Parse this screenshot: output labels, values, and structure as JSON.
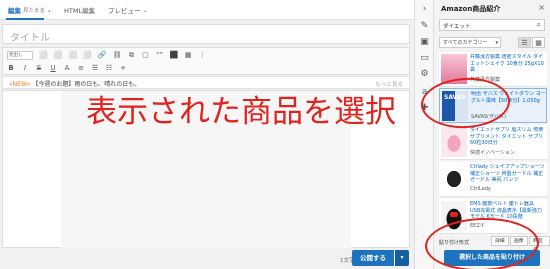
{
  "editor": {
    "tabs": [
      {
        "label": "編集",
        "sub": "見たまま"
      },
      {
        "label": "HTML編集"
      },
      {
        "label": "プレビュー"
      }
    ],
    "title_placeholder": "タイトル",
    "toolbar": {
      "select_label": "見出し",
      "row1": [
        "⬜",
        "⬜",
        "⬜",
        "⬜",
        "🔗",
        "⛓",
        "⧉",
        "▢",
        "“”",
        "⬛",
        "▦",
        "⋮"
      ],
      "row2": [
        "B",
        "I",
        "S",
        "U",
        "A",
        "≡",
        "☰",
        "☷",
        "+"
      ]
    },
    "snippet": {
      "tag": "«NEW»",
      "text": "【今週のお題】雨の日も、晴れの日も。",
      "hint": "もっと見る"
    },
    "char_count": "1文字",
    "publish_label": "公開する",
    "publish_caret": "▾"
  },
  "annotation": "表示された商品を選択",
  "icon_strip": [
    "›",
    "✎",
    "▣",
    "▭",
    "⚙",
    "a",
    "✚"
  ],
  "panel": {
    "title": "Amazon商品紹介",
    "close": "×",
    "search_value": "ダイエット",
    "category": "すべてのカテゴリー",
    "view_list": "☰",
    "view_grid": "▦",
    "products": [
      {
        "name": "井藤漢方製薬 焙胚スタイル ダイエットシェイク 10食分 25gX10袋",
        "maker": "井藤漢方製薬"
      },
      {
        "name": "明治 ザバス ウェイトダウン ヨーグルト風味【50食分】1,050g",
        "maker": "SAVAS(ザバス)"
      },
      {
        "name": "ダイエットサプリ 脂スリム 燃焼 サプリメント ダイエット サプリ 60粒30日分",
        "maker": "快適イノベーション"
      },
      {
        "name": "Ctrlady シェイプアップショーツ 補正ショーツ 骨盤ガードル 補正ガードル 美尻 パンツ",
        "maker": "CtrlLady"
      },
      {
        "name": "EMS 腹筋ベルト 腹トレ器具 USB充電式 液晶表示【最新強力モデル 6モード 10段階",
        "maker": "EEZ-Y"
      }
    ],
    "savas_img_label": "SAVAS",
    "paste_label": "貼り付け形式",
    "paste_options": [
      "詳細",
      "画像",
      "商品名"
    ],
    "insert_label": "選択した商品を貼り付け"
  }
}
